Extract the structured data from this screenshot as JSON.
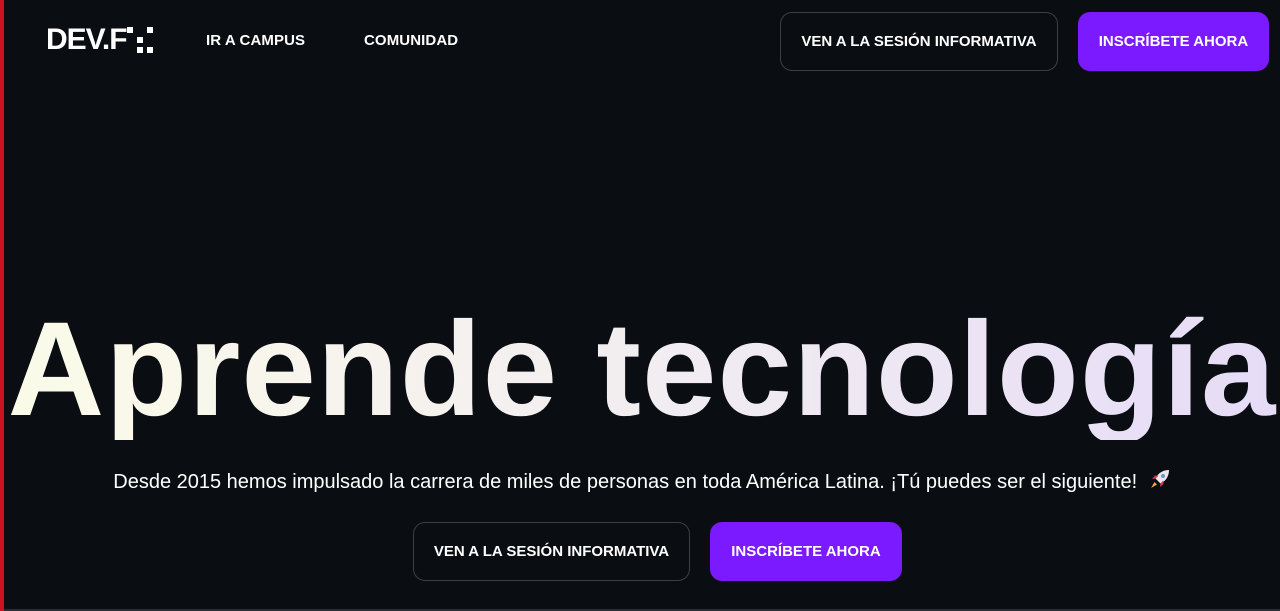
{
  "header": {
    "logo_text": "DEV.F",
    "nav": {
      "campus_label": "IR A CAMPUS",
      "comunidad_label": "COMUNIDAD"
    },
    "info_session_label": "VEN A LA SESIÓN INFORMATIVA",
    "enroll_label": "INSCRÍBETE AHORA"
  },
  "hero": {
    "title": "Aprende tecnología",
    "subtitle": "Desde 2015 hemos impulsado la carrera de miles de personas en toda América Latina. ¡Tú puedes ser el siguiente!",
    "subtitle_icon": "rocket-icon",
    "info_session_label": "VEN A LA SESIÓN INFORMATIVA",
    "enroll_label": "INSCRÍBETE AHORA"
  },
  "colors": {
    "background": "#0a0d12",
    "primary": "#7b19ff",
    "outline_border": "#3c3f46",
    "left_edge": "#c8141e"
  }
}
